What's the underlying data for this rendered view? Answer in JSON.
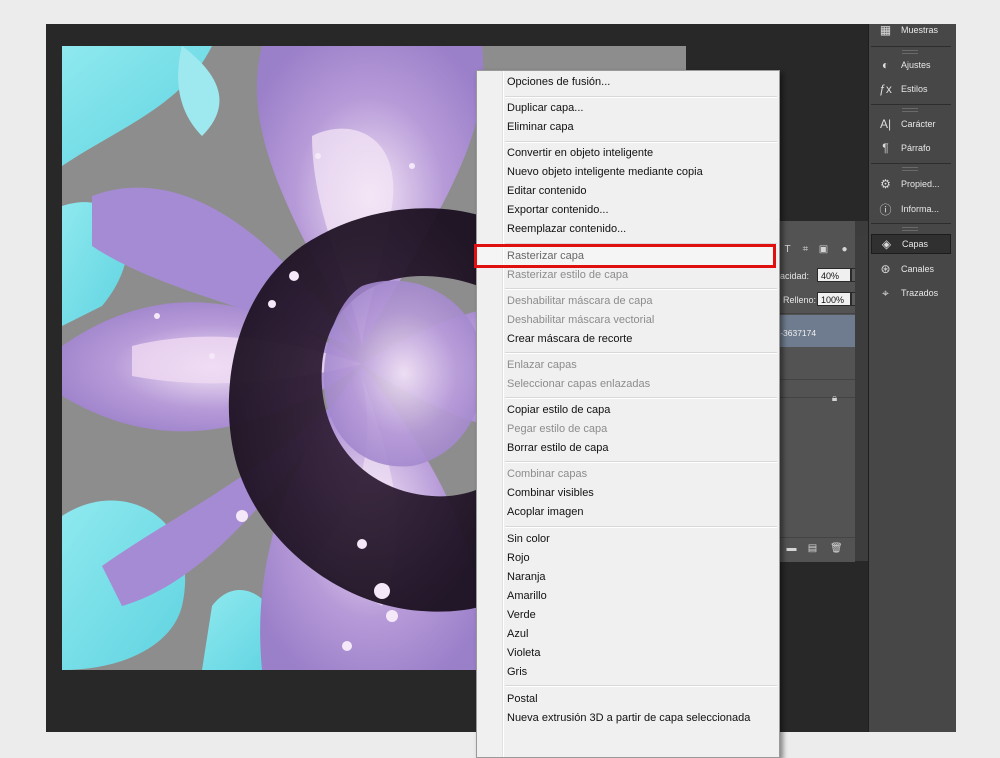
{
  "context_menu": {
    "items": [
      {
        "label": "Opciones de fusión...",
        "enabled": true
      },
      {
        "label": "Duplicar capa...",
        "enabled": true
      },
      {
        "label": "Eliminar capa",
        "enabled": true
      },
      {
        "label": "Convertir en objeto inteligente",
        "enabled": true
      },
      {
        "label": "Nuevo objeto inteligente mediante copia",
        "enabled": true
      },
      {
        "label": "Editar contenido",
        "enabled": true
      },
      {
        "label": "Exportar contenido...",
        "enabled": true
      },
      {
        "label": "Reemplazar contenido...",
        "enabled": true
      },
      {
        "label": "Rasterizar capa",
        "enabled": true,
        "highlighted": true
      },
      {
        "label": "Rasterizar estilo de capa",
        "enabled": false
      },
      {
        "label": "Deshabilitar máscara de capa",
        "enabled": false
      },
      {
        "label": "Deshabilitar máscara vectorial",
        "enabled": false
      },
      {
        "label": "Crear máscara de recorte",
        "enabled": true
      },
      {
        "label": "Enlazar capas",
        "enabled": false
      },
      {
        "label": "Seleccionar capas enlazadas",
        "enabled": false
      },
      {
        "label": "Copiar estilo de capa",
        "enabled": true
      },
      {
        "label": "Pegar estilo de capa",
        "enabled": false
      },
      {
        "label": "Borrar estilo de capa",
        "enabled": true
      },
      {
        "label": "Combinar capas",
        "enabled": false
      },
      {
        "label": "Combinar visibles",
        "enabled": true
      },
      {
        "label": "Acoplar imagen",
        "enabled": true
      },
      {
        "label": "Sin color",
        "enabled": true
      },
      {
        "label": "Rojo",
        "enabled": true
      },
      {
        "label": "Naranja",
        "enabled": true
      },
      {
        "label": "Amarillo",
        "enabled": true
      },
      {
        "label": "Verde",
        "enabled": true
      },
      {
        "label": "Azul",
        "enabled": true
      },
      {
        "label": "Violeta",
        "enabled": true
      },
      {
        "label": "Gris",
        "enabled": true
      },
      {
        "label": "Postal",
        "enabled": true
      },
      {
        "label": "Nueva extrusión 3D a partir de capa seleccionada",
        "enabled": true
      }
    ],
    "highlight_color": "#e01010"
  },
  "layers_panel": {
    "opacity_label": "pacidad:",
    "opacity_value": "40%",
    "fill_label": "Relleno:",
    "fill_value": "100%",
    "layer_name": "rt-3637174",
    "selected_color": "#6f7c8f"
  },
  "dock": {
    "items": [
      {
        "label": "Muestras",
        "icon": "swatches-icon"
      },
      {
        "label": "Ajustes",
        "icon": "adjustments-icon"
      },
      {
        "label": "Estilos",
        "icon": "styles-icon"
      },
      {
        "label": "Carácter",
        "icon": "character-icon"
      },
      {
        "label": "Párrafo",
        "icon": "paragraph-icon"
      },
      {
        "label": "Propied...",
        "icon": "properties-icon"
      },
      {
        "label": "Informa...",
        "icon": "info-icon"
      },
      {
        "label": "Capas",
        "icon": "layers-icon",
        "active": true
      },
      {
        "label": "Canales",
        "icon": "channels-icon"
      },
      {
        "label": "Trazados",
        "icon": "paths-icon"
      }
    ]
  }
}
